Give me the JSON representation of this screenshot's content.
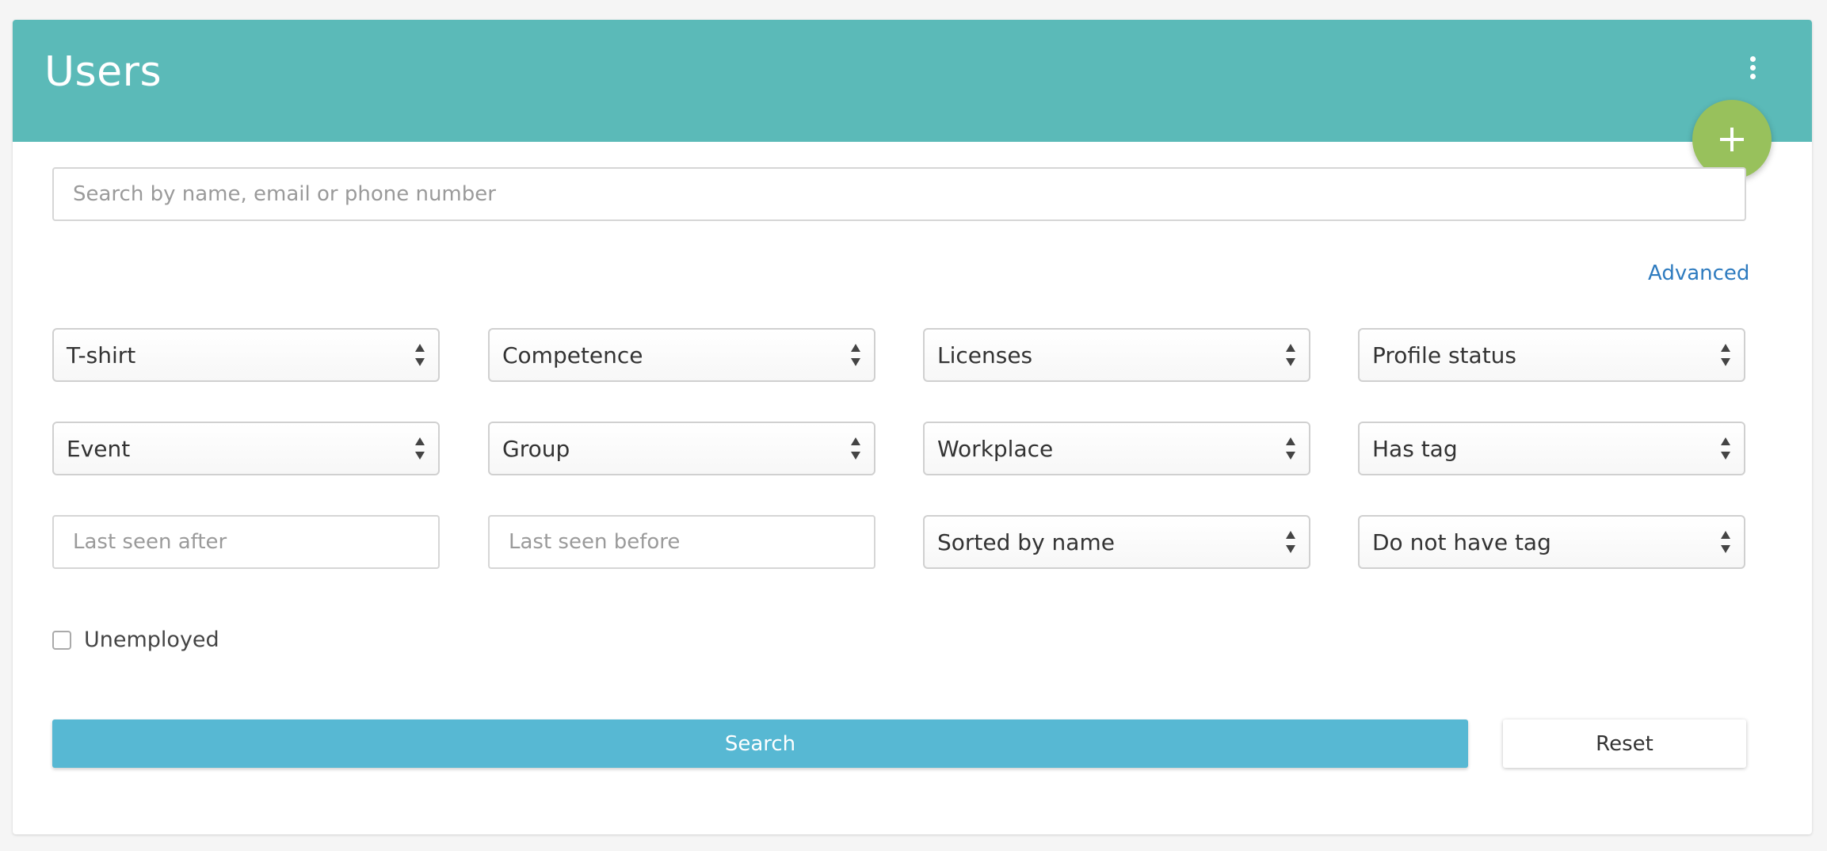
{
  "header": {
    "title": "Users",
    "menu_icon": "more-vertical-icon",
    "add_icon": "plus-icon",
    "header_color": "#5bbab8",
    "fab_color": "#98c15c"
  },
  "search": {
    "placeholder": "Search by name, email or phone number",
    "value": "",
    "advanced_label": "Advanced"
  },
  "filters": {
    "tshirt": "T-shirt",
    "competence": "Competence",
    "licenses": "Licenses",
    "profile_status": "Profile status",
    "event": "Event",
    "group": "Group",
    "workplace": "Workplace",
    "has_tag": "Has tag",
    "last_seen_after_placeholder": "Last seen after",
    "last_seen_before_placeholder": "Last seen before",
    "sort": "Sorted by name",
    "do_not_have_tag": "Do not have tag"
  },
  "unemployed": {
    "label": "Unemployed",
    "checked": false
  },
  "actions": {
    "search_label": "Search",
    "reset_label": "Reset",
    "search_color": "#57b8d3"
  }
}
